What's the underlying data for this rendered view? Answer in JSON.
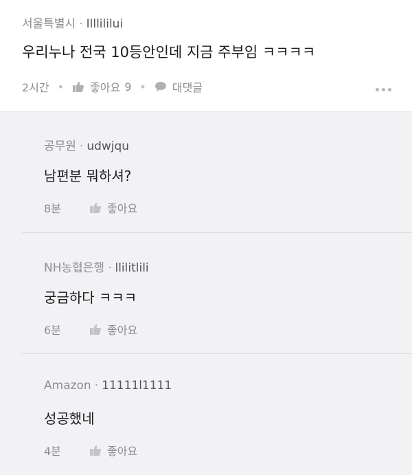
{
  "post": {
    "location": "서울특별시",
    "username": "Illlililui",
    "content": "우리누나 전국 10등안인데 지금 주부임 ㅋㅋㅋㅋ",
    "time": "2시간",
    "like_label": "좋아요",
    "like_count": "9",
    "reply_label": "대댓글"
  },
  "meta_separator": "·",
  "comments": [
    {
      "affiliation": "공무원",
      "username": "udwjqu",
      "content": "남편분 뭐하셔?",
      "time": "8분",
      "like_label": "좋아요"
    },
    {
      "affiliation": "NH농협은행",
      "username": "llilitlili",
      "content": "궁금하다 ㅋㅋㅋ",
      "time": "6분",
      "like_label": "좋아요"
    },
    {
      "affiliation": "Amazon",
      "username": "11111l1111",
      "content": "성공했네",
      "time": "4분",
      "like_label": "좋아요"
    }
  ],
  "icons": {
    "like": "thumbs-up-icon",
    "reply": "speech-bubble-icon",
    "more": "more-dots-icon"
  },
  "colors": {
    "background": "#f2f2f4",
    "card": "#ffffff",
    "muted_text": "#8d8d92",
    "primary_text": "#1c1c1e"
  }
}
